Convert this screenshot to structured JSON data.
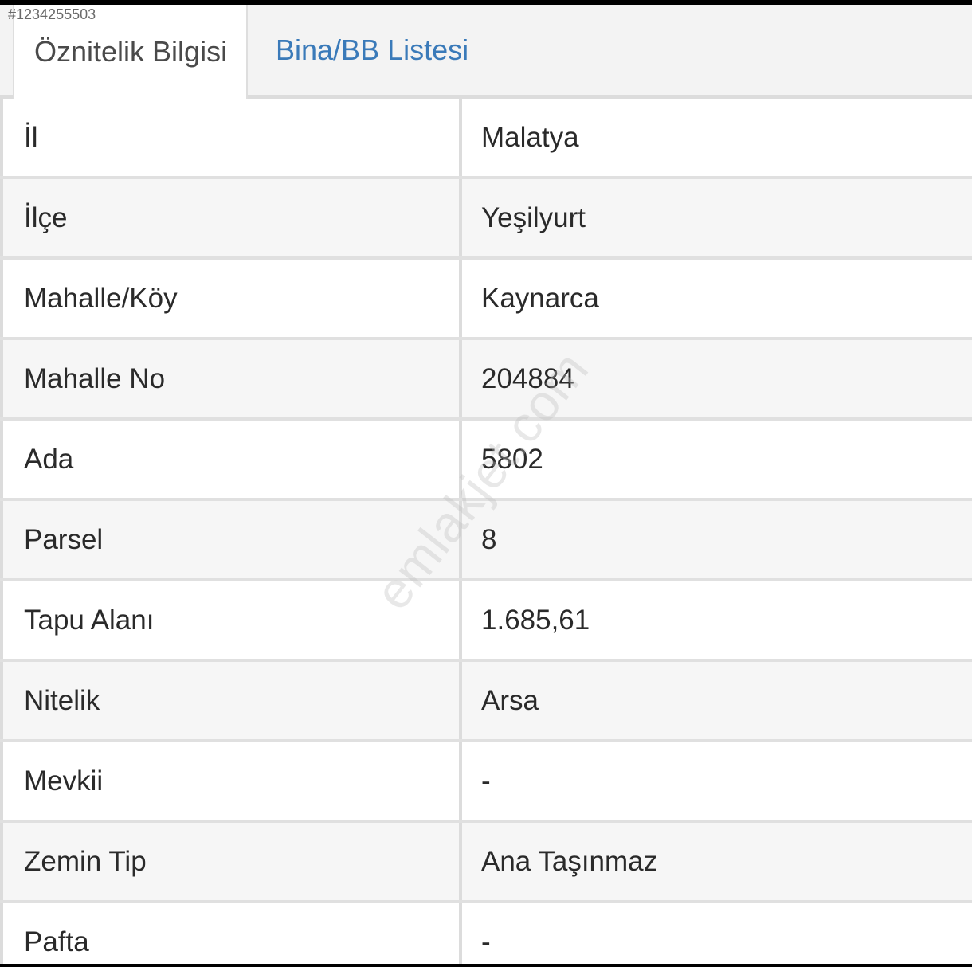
{
  "listing_id": "#1234255503",
  "tabs": [
    {
      "label": "Öznitelik Bilgisi",
      "active": true
    },
    {
      "label": "Bina/BB Listesi",
      "active": false
    }
  ],
  "rows": [
    {
      "label": "İl",
      "value": "Malatya"
    },
    {
      "label": "İlçe",
      "value": "Yeşilyurt"
    },
    {
      "label": "Mahalle/Köy",
      "value": "Kaynarca"
    },
    {
      "label": "Mahalle No",
      "value": "204884"
    },
    {
      "label": "Ada",
      "value": "5802"
    },
    {
      "label": "Parsel",
      "value": "8"
    },
    {
      "label": "Tapu Alanı",
      "value": "1.685,61"
    },
    {
      "label": "Nitelik",
      "value": "Arsa"
    },
    {
      "label": "Mevkii",
      "value": "-"
    },
    {
      "label": "Zemin Tip",
      "value": "Ana Taşınmaz"
    },
    {
      "label": "Pafta",
      "value": "-"
    }
  ],
  "watermark": "emlakjet.com",
  "colors": {
    "active_tab_text": "#4a4a4a",
    "inactive_tab_text": "#3a7ab9",
    "row_text": "#2a2a2a"
  }
}
